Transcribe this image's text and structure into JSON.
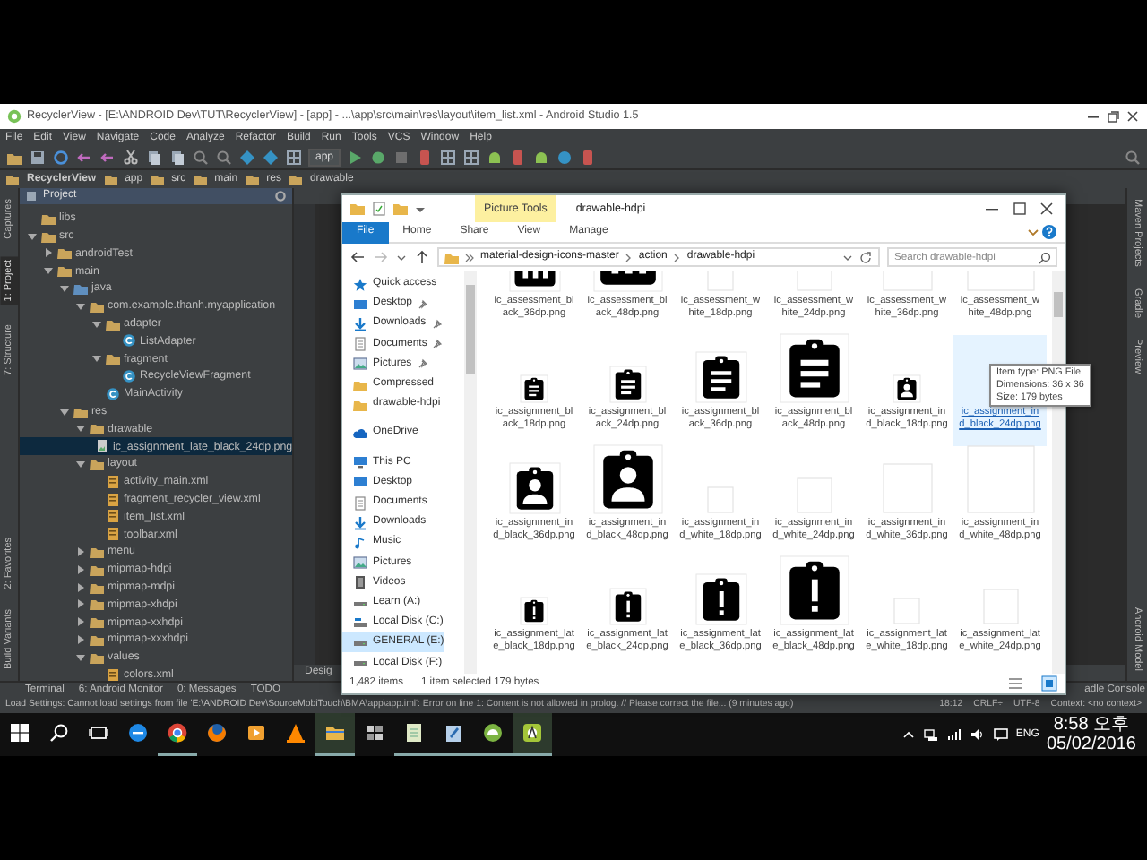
{
  "android_studio": {
    "title": "RecyclerView - [E:\\ANDROID Dev\\TUT\\RecyclerView] - [app] - ...\\app\\src\\main\\res\\layout\\item_list.xml - Android Studio 1.5",
    "menu": [
      "File",
      "Edit",
      "View",
      "Navigate",
      "Code",
      "Analyze",
      "Refactor",
      "Build",
      "Run",
      "Tools",
      "VCS",
      "Window",
      "Help"
    ],
    "run_config": "app",
    "breadcrumb": [
      "RecyclerView",
      "app",
      "src",
      "main",
      "res",
      "drawable"
    ],
    "left_tools": {
      "top": [
        {
          "label": "Captures",
          "selected": false
        },
        {
          "label": "1: Project",
          "selected": true
        },
        {
          "label": "7: Structure",
          "selected": false
        }
      ],
      "bottom": [
        {
          "label": "2: Favorites",
          "selected": false
        },
        {
          "label": "Build Variants",
          "selected": false
        }
      ]
    },
    "project_panel": {
      "title": "Project",
      "tree": [
        {
          "label": "libs",
          "kind": "folder",
          "selected": false
        },
        {
          "label": "src",
          "kind": "folder",
          "expanded": true,
          "selected": false,
          "children": [
            {
              "label": "androidTest",
              "kind": "folder",
              "expanded": false,
              "selected": false
            },
            {
              "label": "main",
              "kind": "folder",
              "expanded": true,
              "selected": false,
              "children": [
                {
                  "label": "java",
                  "kind": "source_folder",
                  "expanded": true,
                  "selected": false,
                  "children": [
                    {
                      "label": "com.example.thanh.myapplication",
                      "kind": "folder",
                      "expanded": true,
                      "selected": false,
                      "children": [
                        {
                          "label": "adapter",
                          "kind": "folder",
                          "expanded": true,
                          "selected": false,
                          "children": [
                            {
                              "label": "ListAdapter",
                              "kind": "class",
                              "selected": false
                            }
                          ]
                        },
                        {
                          "label": "fragment",
                          "kind": "folder",
                          "expanded": true,
                          "selected": false,
                          "children": [
                            {
                              "label": "RecycleViewFragment",
                              "kind": "class",
                              "selected": false
                            }
                          ]
                        },
                        {
                          "label": "MainActivity",
                          "kind": "class",
                          "selected": false
                        }
                      ]
                    }
                  ]
                },
                {
                  "label": "res",
                  "kind": "folder",
                  "expanded": true,
                  "selected": false,
                  "children": [
                    {
                      "label": "drawable",
                      "kind": "folder",
                      "expanded": true,
                      "selected": false,
                      "children": [
                        {
                          "label": "ic_assignment_late_black_24dp.png",
                          "kind": "image",
                          "selected": true
                        }
                      ]
                    },
                    {
                      "label": "layout",
                      "kind": "folder",
                      "expanded": true,
                      "selected": false,
                      "children": [
                        {
                          "label": "activity_main.xml",
                          "kind": "xml",
                          "selected": false
                        },
                        {
                          "label": "fragment_recycler_view.xml",
                          "kind": "xml",
                          "selected": false
                        },
                        {
                          "label": "item_list.xml",
                          "kind": "xml",
                          "selected": false
                        },
                        {
                          "label": "toolbar.xml",
                          "kind": "xml",
                          "selected": false
                        }
                      ]
                    },
                    {
                      "label": "menu",
                      "kind": "folder",
                      "expanded": false,
                      "selected": false
                    },
                    {
                      "label": "mipmap-hdpi",
                      "kind": "folder",
                      "expanded": false,
                      "selected": false
                    },
                    {
                      "label": "mipmap-mdpi",
                      "kind": "folder",
                      "expanded": false,
                      "selected": false
                    },
                    {
                      "label": "mipmap-xhdpi",
                      "kind": "folder",
                      "expanded": false,
                      "selected": false
                    },
                    {
                      "label": "mipmap-xxhdpi",
                      "kind": "folder",
                      "expanded": false,
                      "selected": false
                    },
                    {
                      "label": "mipmap-xxxhdpi",
                      "kind": "folder",
                      "expanded": false,
                      "selected": false
                    },
                    {
                      "label": "values",
                      "kind": "folder",
                      "expanded": true,
                      "selected": false,
                      "children": [
                        {
                          "label": "colors.xml",
                          "kind": "xml",
                          "selected": false
                        }
                      ]
                    }
                  ]
                }
              ]
            }
          ]
        }
      ]
    },
    "editor": {
      "bottom_tab": "Desig"
    },
    "right_tools": {
      "top": [
        "Maven Projects",
        "Gradle",
        "Preview"
      ],
      "bottom": [
        "Android Model"
      ]
    },
    "bottom_tools": {
      "left": [
        "Terminal",
        "6: Android Monitor",
        "0: Messages",
        "TODO"
      ],
      "right": [
        "adle Console"
      ]
    },
    "status": {
      "message": "Load Settings: Cannot load settings from file 'E:\\ANDROID Dev\\SourceMobiTouch\\BMA\\app\\app.iml': Error on line 1: Content is not allowed in prolog. // Please correct the file... (9 minutes ago)",
      "position": "18:12",
      "line_ending": "CRLF÷",
      "encoding": "UTF-8",
      "context": "Context: <no context>"
    }
  },
  "explorer": {
    "contextual_tab": "Picture Tools",
    "title": "drawable-hdpi",
    "ribbon_tabs": [
      {
        "label": "File",
        "selected": true
      },
      {
        "label": "Home",
        "selected": false
      },
      {
        "label": "Share",
        "selected": false
      },
      {
        "label": "View",
        "selected": false
      },
      {
        "label": "Manage",
        "selected": false
      }
    ],
    "path": [
      "material-design-icons-master",
      "action",
      "drawable-hdpi"
    ],
    "search": {
      "placeholder": "Search drawable-hdpi"
    },
    "nav": [
      {
        "label": "Quick access",
        "kind": "quick",
        "pinned": false,
        "selected": false
      },
      {
        "label": "Desktop",
        "kind": "desktop",
        "pinned": true,
        "selected": false
      },
      {
        "label": "Downloads",
        "kind": "downloads",
        "pinned": true,
        "selected": false
      },
      {
        "label": "Documents",
        "kind": "documents",
        "pinned": true,
        "selected": false
      },
      {
        "label": "Pictures",
        "kind": "pictures",
        "pinned": true,
        "selected": false
      },
      {
        "label": "Compressed",
        "kind": "folder",
        "pinned": false,
        "selected": false
      },
      {
        "label": "drawable-hdpi",
        "kind": "folder",
        "pinned": false,
        "selected": false
      },
      {
        "label": "OneDrive",
        "kind": "onedrive",
        "pinned": false,
        "selected": false
      },
      {
        "label": "This PC",
        "kind": "pc",
        "pinned": false,
        "selected": false
      },
      {
        "label": "Desktop",
        "kind": "desktop",
        "pinned": false,
        "selected": false
      },
      {
        "label": "Documents",
        "kind": "documents",
        "pinned": false,
        "selected": false
      },
      {
        "label": "Downloads",
        "kind": "downloads",
        "pinned": false,
        "selected": false
      },
      {
        "label": "Music",
        "kind": "music",
        "pinned": false,
        "selected": false
      },
      {
        "label": "Pictures",
        "kind": "pictures",
        "pinned": false,
        "selected": false
      },
      {
        "label": "Videos",
        "kind": "videos",
        "pinned": false,
        "selected": false
      },
      {
        "label": "Learn (A:)",
        "kind": "drive",
        "pinned": false,
        "selected": false
      },
      {
        "label": "Local Disk (C:)",
        "kind": "system_drive",
        "pinned": false,
        "selected": false
      },
      {
        "label": "GENERAL (E:)",
        "kind": "drive",
        "pinned": false,
        "selected": true
      },
      {
        "label": "Local Disk (F:)",
        "kind": "drive",
        "pinned": false,
        "selected": false
      }
    ],
    "files": [
      {
        "name": "ic_assessment_black_36dp.png",
        "kind": "assessment_large",
        "selected": false
      },
      {
        "name": "ic_assessment_black_48dp.png",
        "kind": "assessment_xlarge",
        "selected": false
      },
      {
        "name": "ic_assessment_white_18dp.png",
        "kind": "blank_small",
        "selected": false
      },
      {
        "name": "ic_assessment_white_24dp.png",
        "kind": "blank_medium",
        "selected": false
      },
      {
        "name": "ic_assessment_white_36dp.png",
        "kind": "blank_large",
        "selected": false
      },
      {
        "name": "ic_assessment_white_48dp.png",
        "kind": "blank_xlarge",
        "selected": false
      },
      {
        "name": "ic_assignment_black_18dp.png",
        "kind": "assignment_small",
        "selected": false
      },
      {
        "name": "ic_assignment_black_24dp.png",
        "kind": "assignment_medium",
        "selected": false
      },
      {
        "name": "ic_assignment_black_36dp.png",
        "kind": "assignment_large",
        "selected": false
      },
      {
        "name": "ic_assignment_black_48dp.png",
        "kind": "assignment_xlarge",
        "selected": false
      },
      {
        "name": "ic_assignment_ind_black_18dp.png",
        "kind": "assignment_ind_small",
        "selected": false
      },
      {
        "name": "ic_assignment_ind_black_24dp.png",
        "selected": true
      },
      {
        "name": "ic_assignment_ind_black_36dp.png",
        "kind": "assignment_ind_large",
        "selected": false
      },
      {
        "name": "ic_assignment_ind_black_48dp.png",
        "kind": "assignment_ind_xlarge",
        "selected": false
      },
      {
        "name": "ic_assignment_ind_white_18dp.png",
        "kind": "blank_small",
        "selected": false
      },
      {
        "name": "ic_assignment_ind_white_24dp.png",
        "kind": "blank_medium",
        "selected": false
      },
      {
        "name": "ic_assignment_ind_white_36dp.png",
        "kind": "blank_large",
        "selected": false
      },
      {
        "name": "ic_assignment_ind_white_48dp.png",
        "kind": "blank_xlarge",
        "selected": false
      },
      {
        "name": "ic_assignment_late_black_18dp.png",
        "kind": "assignment_late_small",
        "selected": false
      },
      {
        "name": "ic_assignment_late_black_24dp.png",
        "kind": "assignment_late_medium",
        "selected": false
      },
      {
        "name": "ic_assignment_late_black_36dp.png",
        "kind": "assignment_late_large",
        "selected": false
      },
      {
        "name": "ic_assignment_late_black_48dp.png",
        "kind": "assignment_late_xlarge",
        "selected": false
      },
      {
        "name": "ic_assignment_late_white_18dp.png",
        "kind": "blank_small",
        "selected": false
      },
      {
        "name": "ic_assignment_late_white_24dp.png",
        "kind": "blank_medium",
        "selected": false
      }
    ],
    "tooltip": [
      "Item type: PNG File",
      "Dimensions: 36 x 36",
      "Size: 179 bytes"
    ],
    "status": {
      "count": "1,482 items",
      "selection": "1 item selected  179 bytes"
    }
  },
  "taskbar": {
    "apps": [
      {
        "kind": "edge",
        "open": false,
        "selected": false
      },
      {
        "kind": "chrome",
        "open": true,
        "selected": false
      },
      {
        "kind": "firefox",
        "open": false,
        "selected": false
      },
      {
        "kind": "media",
        "open": false,
        "selected": false
      },
      {
        "kind": "vlc",
        "open": false,
        "selected": false
      },
      {
        "kind": "explorer",
        "open": true,
        "selected": true
      },
      {
        "kind": "apps",
        "open": false,
        "selected": false
      },
      {
        "kind": "notepad",
        "open": true,
        "selected": false
      },
      {
        "kind": "editor",
        "open": true,
        "selected": false
      },
      {
        "kind": "android",
        "open": true,
        "selected": false
      },
      {
        "kind": "studio",
        "open": true,
        "selected": true
      }
    ],
    "language": "ENG",
    "time": "8:58 오후",
    "date": "05/02/2016"
  }
}
